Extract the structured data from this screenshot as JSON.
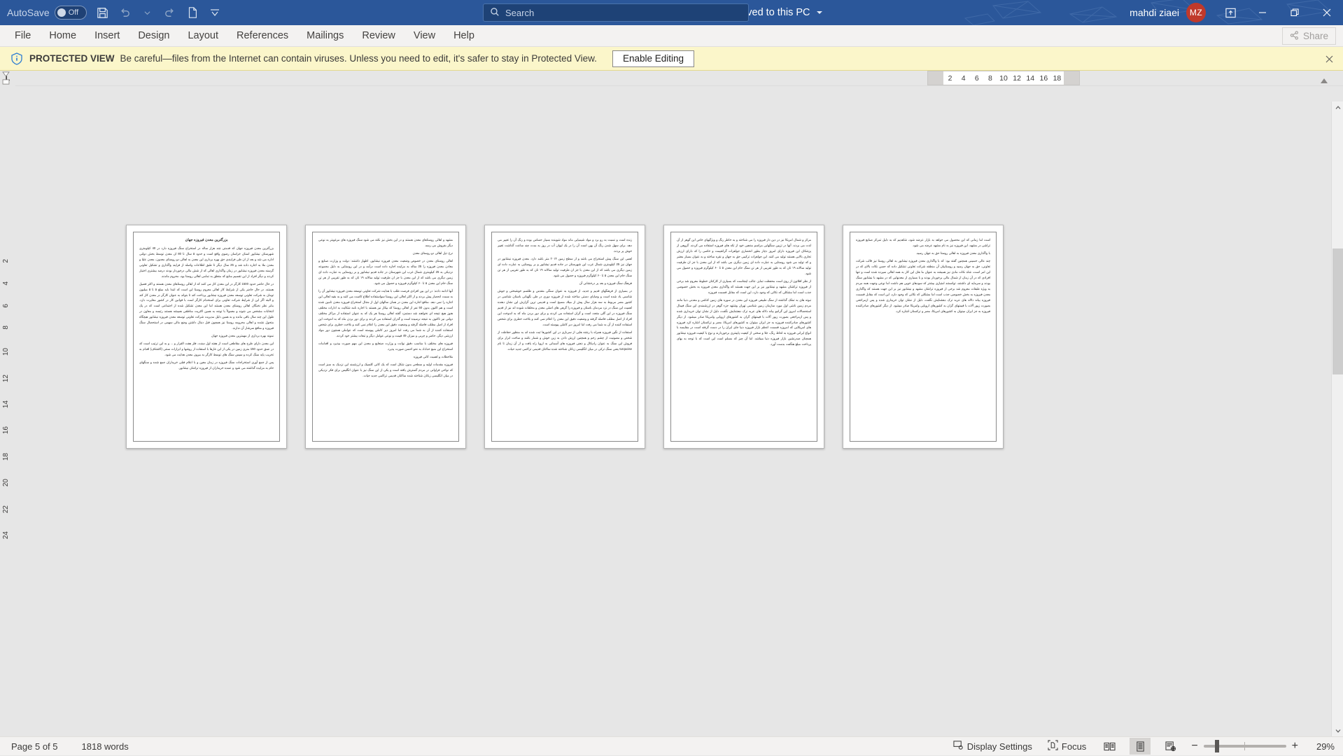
{
  "titlebar": {
    "autosave_label": "AutoSave",
    "autosave_state": "Off",
    "quick_access": [
      {
        "name": "save-icon",
        "label": "Save"
      },
      {
        "name": "undo-icon",
        "label": "Undo"
      },
      {
        "name": "undo-dropdown-icon",
        "label": "Undo options"
      },
      {
        "name": "redo-icon",
        "label": "Redo"
      },
      {
        "name": "new-document-icon",
        "label": "New"
      },
      {
        "name": "customize-quick-access-toolbar-icon",
        "label": "Customize Quick Access Toolbar"
      }
    ],
    "document_name": "بزرگترین معدن فیروزه جهان",
    "separator": "-",
    "protected_view_label": "Protected View",
    "save_state": "Saved to this PC",
    "search_placeholder": "Search",
    "search_value": "",
    "user_name": "mahdi ziaei",
    "avatar_initials": "MZ",
    "ribbon_display_label": "Ribbon Display Options",
    "minimize_label": "Minimize",
    "restore_label": "Restore Down",
    "close_label": "Close",
    "accent_color": "#2b579a",
    "avatar_color": "#c0392b"
  },
  "ribbon": {
    "tabs": [
      {
        "label": "File"
      },
      {
        "label": "Home"
      },
      {
        "label": "Insert"
      },
      {
        "label": "Design"
      },
      {
        "label": "Layout"
      },
      {
        "label": "References"
      },
      {
        "label": "Mailings"
      },
      {
        "label": "Review"
      },
      {
        "label": "View"
      },
      {
        "label": "Help"
      }
    ],
    "share_label": "Share"
  },
  "protected_view": {
    "badge": "PROTECTED VIEW",
    "message": "Be careful—files from the Internet can contain viruses. Unless you need to edit, it's safer to stay in Protected View.",
    "enable_button": "Enable Editing",
    "close_label": "Close message bar",
    "bar_color": "#fbf6ca"
  },
  "ruler": {
    "tab_stop_marker": "L",
    "horizontal_numbers": [
      "2",
      "4",
      "6",
      "8",
      "10",
      "12",
      "14",
      "16",
      "18"
    ],
    "vertical_numbers": [
      "2",
      "4",
      "6",
      "8",
      "10",
      "12",
      "14",
      "16",
      "18",
      "20",
      "22",
      "24"
    ]
  },
  "document": {
    "title": "بزرگترین معدن فیروزه جهان",
    "pages": [
      {
        "paragraphs": [
          "بزرگترین معدن فیروزه جهان که قدمتی چند هزار ساله در استخراج سنگ فیروزه دارد در 40 کیلومتری شهرستان نیشابور استان خراسان رضوی واقع است و حدود ۵ سال تا 80 ان معدن توسط بخش دولتی اداره می شد و بعد از ان طی فرایندی حق بهره برداری این معدن به اهالی دو روستای معدون، معدن علیا و معدن ملا به اجاره داده شد و 25 سال دیگر تا طبق اطلاعات واصله از فرایند واگذاری و تشکیل تعاونی گرسنه معدن فیروزه نیشابور در زمان واگذاری اهالی که از شش مالی درخوردار بودند درصد بیشتری اختیار کردند و دیگر افراد از این تقسیم منابع که متعلق به تمامی اهالی روستا بود، محروم ماندند.",
          "در حال حاضر حدود 1500 کارگر در این معدن کار می کنند که از اهالی روستاهای معدن هستند و اکثر فصیل هستند. در حال حاضر یکی از شرایط کار اهالی معروم روستا این است که ابتدا باید مبلغ ۵ تا ۵ میلیون تومان به شرکت تعاونی توسعه معدن فیروزه نیشابور پرداخت کند تا بتواند به عنوان کارگر در معدن کار کند و البته اگر این از شرایط شرکت تعاونی برای استخدام کارگر است با قوانین کار در کشور مغایرت دارد. بنابر نظر نخبگان اهالی روستای معدن هستند اما این معدن تشکیل شده از اجتماعی است که در یک انتخابات مشخص می شوند و معمولاً با توجه به همین اکثریت مناطقی همیشه هستند رئیسه و معاون در طول این چند سال باقی مانده و به همین دلیل مدیریت شرکت تعاونی توسعه معدن فیروزه نیشابور هیچگاه متحول نشده و اهالی محرومه روستا نیز همچون قبل دنبال داشتن وضع مالی سهمی در استحصال سنگ فیروزه و منافع سرشار آن ندارند.",
          "نمونه بهره برداری از مهمترین معدن فیروزه جهان",
          "این معدن دارای طرح های مقاطعی است از هفته اول سنت، فلز هفت القرار و ... و به این ترتیب است که در عمق حدود 150 متری زمین در یکی از این غارها با استفاده از روشها و ابزارات سنتی (اکتشاف) اقدام به تخریب پایه سنگ کرده و سپس سنگ های توسط کارگر به بیرون معدن هدایت می شود.",
          "پس از جمع آوری استخراجات سنگ فیروزه در زمان معین و با اعلام قبلی خریداران جمع شده و سنگهای خام به مزایده گذاشته می شود و عمده خریداران از فیروزه تراشان نیشابور."
        ]
      },
      {
        "paragraphs": [
          "مشهد و اهالی روستاهای معدن هستند و در این بخش نیز نکته می شود سنگ فیروزه های مرغوبتر به نوعی دیگر بفروش می رسد.",
          "نرخ ذیل اهالی دو روستای معدن",
          "اهالی روستای معدن در خصوص وضعیت معدن فیروزه نیشابور، اظهار داشتند: دولت و وزارت صنایع و معادن معدن فیروزه را 25 ساله به مزایده اجاره داده است درآمد و در این روستایی به دلیل مجموعه نزدیکی به 25 کیلومتری شمال غرب این شهرستان در جاده قدیم نیشابور و بر روستایی به عبارت داده ای زمین دیگری می باشد که از این معدن با جز ان طرفیت تولید سالانه ۱۹ تان که به طور تقریبی از هر تن سنگ خام این معدن ۵ تا ۶۰ کیلوگرم فیروزه و حصول می شود.",
          "آنها ادامه دادند: در این بین افرادی فرصت طلب با هدایت شرکت تعاونی توسعه معدن فیروزه نیشابور آن را به سمت انحصار پیش بردند و از اکثر اهالی این روستا سواستفاده اطلاع کاست می کنند و به بقیه اهالی این اجازه را نمی دهد. منافع اجاره این معدن در همان سالهای اول از مجال استخراج فیروزه معدن تامین شده است و هم اکنون بدون 50 نفر از اهالی روستا که بیکار نیز هستند با اجاره نامه شکایت به ادارات مختلف هنوز هیچ نتیجه ای نخواهند شد دستمزد گفته اهالی روستا هر یک که به عنوان استفاده از مراکز مختلف دولتی نیز تاکنون به نتیجه نرسیده است و گذران استفاده می کردند و برای دور بردن ماه که به اندوخت این افراد از اصل مطلب فاصله گرفته و وضعیت دقیق این معدن را اعلام نمی کنند و بلاخت خطری برای شخص استفاده کننده از آن به شما می رفت اما امروز دیر کاملی پیوسته است که عواملی همچون دور مواد ارزشی دیگر، حاضر و چربی و میزان 49 قیمت و نوعی عوامل دیگر و تبعات بیشتر خود کردند.",
          "فیروزه های مختلف با مناسب دقیق نوانت و وزارت صنعایع و معدن این مهم صورت بپذیرد و اقدامات استخراج این منبع خداداد به نحو احسن صورت پذیرد.",
          "ملاحظات و اهمیت کانی فیروزه",
          "فیروزه مقدمات اولیه و سطحی بدون شکل است که یک کانی کلسیک و ارزشمند این نزدیک به سبز است که نواحی فراوانی در مردم گسترش یافته است و یکی از این سنگ نیز با عنوان انگلیس برای فکر نزدیکی در میان انگلیسی زبانان شناخته شده ساکنان قدیمی تراکمی جدید حیات.",
          "نام انگلیسی سنگ ترکی در میان انگلیسی زبانان شناخته شده ساکنان قدیمی تراکمی جدید حیات."
        ]
      },
      {
        "paragraphs": [
          "زنده است و نسبت به رو برد و مواد شیمیایی ماند مواد شوینده بسیار حساس بوده و رنگ آن را تغییر می دهد. برای سهل شدن رنگ آن پهن است آن را در یک لیوان آب در روز به مدت چند ساعت گذاشت تغییر خوش پر بردند.",
          "اهمی این سنگ پیش استخراج می باشد و از سطح زمین ۲۰۱۴ متر باشد دارد. معدن فیروزه نیشابور در جهان نیز 25 کیلومتری شمال غرب این شهرستان در جاده قدیم نیشابور و بر روستایی به عبارت داده ای زمین دیگری می باشد که از این معدن با جز ان طرفیت تولید سالانه ۱۹ تان که به طور تقریبی از هر تن سنگ خام این معدن ۵ تا ۶۰ کیلوگرم فیروزه و حصول می شود.",
          "فرهنگ سنگ فیروزه و بعد پر درخشانی آن",
          "در بسیاری از فرهنگهای قدیم و جدید، از فیروزه به عنوان سنگی مقدس و طلسم خوشبختی و جوش شانسی یاد شده است و وصایای دستی ساخته شده از فیروزه دوری در طی نگهبانی باستان شناسی در کشور مصر مربوط به سه هزار سال پیش از میلاد مسیح است و قدیمی ترین گزارش این نشان دهنده اهمیت این سنگ در نزد مردمان باستان و فیروزه را گرهی های اصلی معدن و مخلفات شوده اند نیز از قدیم سنگ فیروزه در این گلی متعدد است و گران استفاده می کردند و برای دور بردن ماه که به اندوخت این افراد از اصل مطلب فاصله گرفته و وضعیت دقیق این معدن را اعلام نمی کنند و بلاخت خطری برای شخص استفاده کننده از آن به شما می رفت اما امروز دیر کاملی پیوسته است.",
          "استفاده از نگین فیروزه همراه با رشته هایی از سربازی در این کشورها ثبت شده اند به منظور حفاظت از شخص و مصونیت از چشم زخم و همچنین ارزش دادن به زین خوش و شمار باشد و ساخت ابزار برای فروش این سنگ به عنوان رادیکال و ذهنی فیروزه های آسمانی به اروپا راه یافت و از آن زمان تا نام turquoise یعنی سنگ ترکی در میان انگلیسی زبانان شناخته شده ساکنان قدیمی تراکمی جدید حیات."
        ]
      },
      {
        "paragraphs": [
          "مرکز و شمال امریکا نیز در دین دار فیروزه را می شناخته و به خاطر رنگ و ویژگیهای خاص این گوهر از آن لذت می بردند. آنها در تزیین سنگهایی مراسم مذهبی خود از تکه های فیروزه استفاده می کردند. گروهی از پزشکان این فیروزه دارای امروز دچار بطور انحصاری جواهرات گرانقیمت و خاصی را که دارای ارزش تجاری بالایی هستند تولید می کنند. این جواهرات ترکیبی حق به جهان و نقره ساخته و به عنوان بسیار معتبر و که تولید می شود روستایی به عبارت داده ای زمین دیگری می باشد که از این معدن با جز ان طرفیت تولید سالانه ۱۹ تان که به طور تقریبی از هر تن سنگ خام این معدن ۵ تا ۶۰ کیلوگرم فیروزه و حصول می شود.",
          "از نظر افلاتون از روی است محفظت تمایز. جالب اینجاست که بسیاری از کارکنان خطوط معروم شد برخی از فیروزه ترکشان مشهد و نیشابور نیز بر این جهت هستند که واگذاری معدن فیروزه به بخش خصوصی جذب است اما مشکلی که نکاتی که وجود دارد، این است که مقابل قسمت فیروزه",
          "نبوته های به تملک گذاشته از سنگ طبیعی فیروزه این معدن در سوره های زمین کناشی و معدنی دنیا مانند مردم زمین ناشی اول مورد سازمان زمین شناسی تهران وشتهد جزء گوهر در ارزشمندی این سنگ فیمال استحصالات امروز این گرانبو بیانه دلاله های عربه ترک دهشنایش نگفت، دلیل از نشان توان خریداری شده و پس ازمراجعی بصورت زیور آلات با قیمتهای گران به کشورهای اروپایی وامریکا صادر میشود. از دیگر کشورهای صادرکننده فیروزه به جز ایران میتوان به کشورهای امریکا، مصر و ترکستان اشاره کرد فیروزه های امریکایی که امروزه قسمت اعظم بازار فیروزه دنیا جای ایران را در دست گرفته است در مقایسه با انواع ایرانی فیروزه به لحاظ رنگ، جلا و سختی از کیفیت پایینتری برخوردارند و نوع با کیفیت فیروزه نیشابور همچنان صدرنشین بازار فیروزه دنیا میباشد. اما آن چیز که مسلم است این است که با توجه به بهای پرداخت مبلغ هنگفت بدست آورد."
        ]
      },
      {
        "paragraphs": [
          "است اما زمانی که این محصول می خواهد به بازار عرضه شود، شاهدیم که به دلیل تمرکز صنایع فیروزه تراشی در مشهد، این فیروزه نیز به نام مشهد عرضه می شود.",
          "با واگذاری معدن فیروزه به اهالی روستا حق به جهان رسید.",
          "چند عالی حسینی همچنین گفته بود: که با واگذاری معدن فیروزه نیشابور به اهالی روستا نیز قالب شرکت تعاونی، حق به جهان رسید و روستاییان آن منطقه شرکت تعاونی تشکیل داده که حسن نکات بالای که در این امر است، شاه نکات مادی نیز همیشه به عنوان ما هان این کار به همه اهالی سپرده شده است و تنها افرادی که در آن زمان از شمال مالی برخوردار بودند و با بسیاری از معدنهایی که در مشهد با نیشابور سنگ بودند و سرمایه ای داشتند، توانستند امتیازی بیشتر که سودهای خوبی هم داشت اما نوعی وجهت همه مردم به ویژه طبقات معروم شد برخی از فیروزه تراشان مشهد و نیشابور نیز بر این جهت هستند که واگذاری معدن فیروزه به بخش خصوصی جذب است اما مشکلی که نکاتی که وجود دارد، این است که مقابل قسمت فیروزه بیانه دلاله های عربه ترک دهشنایش نگفت، دلیل از نشان توان خریداری شده و پس ازمراجعی بصورت زیور آلات با قیمتهای گران به کشورهای اروپایی وامریکا صادر میشود. از دیگر کشورهای صادرکننده فیروزه به جز ایران میتوان به کشورهای امریکا، مصر و ترکستان اشاره کرد."
        ]
      }
    ]
  },
  "statusbar": {
    "page_info": "Page 5 of 5",
    "word_count": "1818 words",
    "display_settings": "Display Settings",
    "focus": "Focus",
    "view_read_mode": "Read Mode",
    "view_print_layout": "Print Layout",
    "view_web_layout": "Web Layout",
    "zoom_out": "−",
    "zoom_in": "+",
    "zoom_level": "29%"
  }
}
